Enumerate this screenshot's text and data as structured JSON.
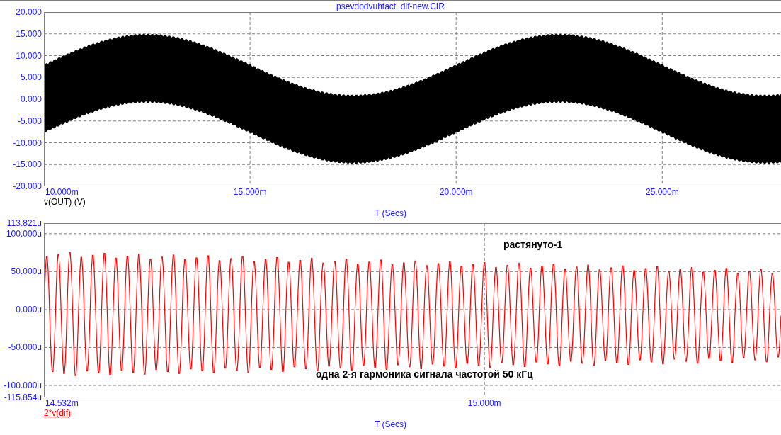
{
  "title": "psevdodvuhtact_dif-new.CIR",
  "panels": [
    {
      "kind": "band",
      "color": "#000000",
      "y_ticks": [
        "20.000",
        "15.000",
        "10.000",
        "5.000",
        "0.000",
        "-5.000",
        "-10.000",
        "-15.000",
        "-20.000"
      ],
      "x_ticks": [
        "10.000m",
        "15.000m",
        "20.000m",
        "25.000m"
      ],
      "trace_label": "v(OUT) (V)",
      "x_axis_label": "T (Secs)"
    },
    {
      "kind": "oscillation",
      "color": "#ff0000",
      "y_ticks": [
        "113.821u",
        "100.000u",
        "50.000u",
        "0.000u",
        "-50.000u",
        "-100.000u",
        "-115.854u"
      ],
      "x_ticks": [
        "14.532m",
        "15.000m"
      ],
      "trace_label": "2*v(dif)",
      "x_axis_label": "T (Secs)",
      "annotations": [
        {
          "text": "растянуто-1"
        },
        {
          "text": "одна 2-я гармоника сигнала частотой 50 кГц"
        }
      ]
    }
  ]
}
